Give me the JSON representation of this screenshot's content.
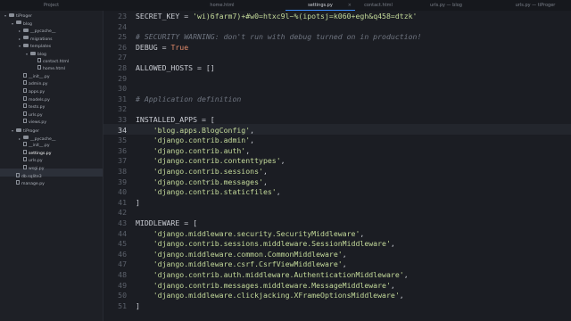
{
  "tabs": [
    {
      "label": "Project"
    },
    {
      "label": "home.html"
    },
    {
      "label": "settings.py",
      "active": true
    },
    {
      "label": "contact.html"
    },
    {
      "label": "urls.py — blog"
    },
    {
      "label": "urls.py — tiProger"
    }
  ],
  "sidebar": {
    "items": [
      {
        "label": "tiProger",
        "kind": "folder",
        "depth": 0,
        "open": true
      },
      {
        "label": "blog",
        "kind": "folder",
        "depth": 1,
        "open": true
      },
      {
        "label": "__pycache__",
        "kind": "folder",
        "depth": 2,
        "open": false
      },
      {
        "label": "migrations",
        "kind": "folder",
        "depth": 2,
        "open": false
      },
      {
        "label": "templates",
        "kind": "folder",
        "depth": 2,
        "open": true
      },
      {
        "label": "blog",
        "kind": "folder",
        "depth": 3,
        "open": true
      },
      {
        "label": "contact.html",
        "kind": "file",
        "depth": 4
      },
      {
        "label": "home.html",
        "kind": "file",
        "depth": 4
      },
      {
        "label": "__init__.py",
        "kind": "file",
        "depth": 2
      },
      {
        "label": "admin.py",
        "kind": "file",
        "depth": 2
      },
      {
        "label": "apps.py",
        "kind": "file",
        "depth": 2
      },
      {
        "label": "models.py",
        "kind": "file",
        "depth": 2
      },
      {
        "label": "tests.py",
        "kind": "file",
        "depth": 2
      },
      {
        "label": "urls.py",
        "kind": "file",
        "depth": 2
      },
      {
        "label": "views.py",
        "kind": "file",
        "depth": 2
      },
      {
        "label": "tiProger",
        "kind": "folder",
        "depth": 1,
        "open": true
      },
      {
        "label": "__pycache__",
        "kind": "folder",
        "depth": 2,
        "open": false
      },
      {
        "label": "__init__.py",
        "kind": "file",
        "depth": 2
      },
      {
        "label": "settings.py",
        "kind": "file",
        "depth": 2,
        "selected": true
      },
      {
        "label": "urls.py",
        "kind": "file",
        "depth": 2
      },
      {
        "label": "wsgi.py",
        "kind": "file",
        "depth": 2
      },
      {
        "label": "db.sqlite3",
        "kind": "file",
        "depth": 1
      },
      {
        "label": "manage.py",
        "kind": "file",
        "depth": 1
      }
    ]
  },
  "editor": {
    "current_line": 34,
    "lines": [
      {
        "num": 23,
        "text": "SECRET_KEY = 'wi)6farm7)+#w0=htxc9l~%(ipotsj=k060+egh&q458=dtzk'"
      },
      {
        "num": 24,
        "text": ""
      },
      {
        "num": 25,
        "text": "# SECURITY WARNING: don't run with debug turned on in production!"
      },
      {
        "num": 26,
        "text": "DEBUG = True"
      },
      {
        "num": 27,
        "text": ""
      },
      {
        "num": 28,
        "text": "ALLOWED_HOSTS = []"
      },
      {
        "num": 29,
        "text": ""
      },
      {
        "num": 30,
        "text": ""
      },
      {
        "num": 31,
        "text": "# Application definition"
      },
      {
        "num": 32,
        "text": ""
      },
      {
        "num": 33,
        "text": "INSTALLED_APPS = ["
      },
      {
        "num": 34,
        "text": "    'blog.apps.BlogConfig',"
      },
      {
        "num": 35,
        "text": "    'django.contrib.admin',"
      },
      {
        "num": 36,
        "text": "    'django.contrib.auth',"
      },
      {
        "num": 37,
        "text": "    'django.contrib.contenttypes',"
      },
      {
        "num": 38,
        "text": "    'django.contrib.sessions',"
      },
      {
        "num": 39,
        "text": "    'django.contrib.messages',"
      },
      {
        "num": 40,
        "text": "    'django.contrib.staticfiles',"
      },
      {
        "num": 41,
        "text": "]"
      },
      {
        "num": 42,
        "text": ""
      },
      {
        "num": 43,
        "text": "MIDDLEWARE = ["
      },
      {
        "num": 44,
        "text": "    'django.middleware.security.SecurityMiddleware',"
      },
      {
        "num": 45,
        "text": "    'django.contrib.sessions.middleware.SessionMiddleware',"
      },
      {
        "num": 46,
        "text": "    'django.middleware.common.CommonMiddleware',"
      },
      {
        "num": 47,
        "text": "    'django.middleware.csrf.CsrfViewMiddleware',"
      },
      {
        "num": 48,
        "text": "    'django.contrib.auth.middleware.AuthenticationMiddleware',"
      },
      {
        "num": 49,
        "text": "    'django.contrib.messages.middleware.MessageMiddleware',"
      },
      {
        "num": 50,
        "text": "    'django.middleware.clickjacking.XFrameOptionsMiddleware',"
      },
      {
        "num": 51,
        "text": "]"
      }
    ]
  },
  "colors": {
    "background": "#1b1d23",
    "string": "#c3d99a",
    "comment": "#6f7580",
    "keyword": "#e08a6a",
    "accent": "#3a8cff"
  }
}
